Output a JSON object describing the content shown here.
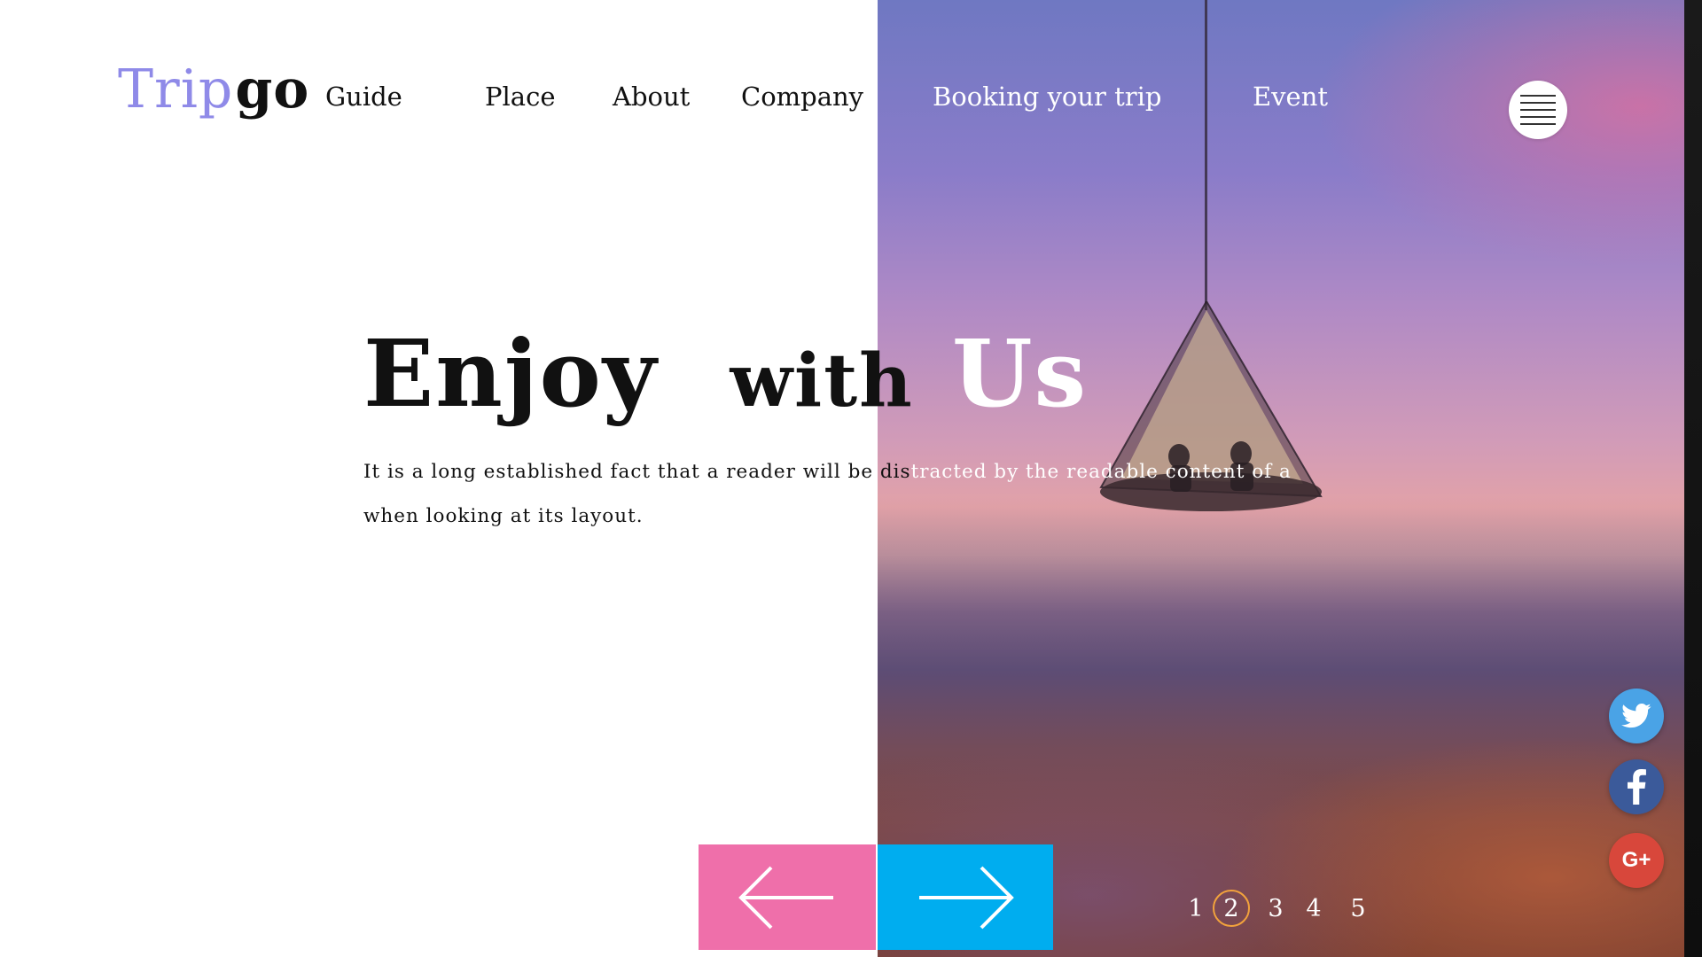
{
  "brand": {
    "part_a": "Trip",
    "part_b": "go"
  },
  "nav": {
    "items": [
      {
        "label": "Guide"
      },
      {
        "label": "Place"
      },
      {
        "label": "About"
      },
      {
        "label": "Company"
      },
      {
        "label": "Booking your trip"
      },
      {
        "label": "Event"
      }
    ]
  },
  "hero": {
    "title": {
      "word1": "Enjoy",
      "word2": "with",
      "word3": "Us"
    },
    "description": {
      "line1_dark": "It is a long established fact that a reader will be dis",
      "line1_light": "tracted by the readable content of a page",
      "line2": "when looking at its layout."
    }
  },
  "pagination": {
    "pages": [
      "1",
      "2",
      "3",
      "4",
      "5"
    ],
    "active": "2"
  },
  "colors": {
    "brand_accent": "#8f8ae8",
    "prev_button": "#ef6faa",
    "next_button": "#00adef",
    "active_page_ring": "#f2a23c",
    "twitter": "#4aa3e6",
    "facebook": "#3b5a9a",
    "google_plus": "#d8473b"
  },
  "icons": {
    "menu": "hamburger-icon",
    "prev": "arrow-left-icon",
    "next": "arrow-right-icon",
    "twitter": "twitter-icon",
    "facebook": "facebook-icon",
    "google_plus": "google-plus-icon"
  },
  "social": {
    "google_plus_label": "G+"
  }
}
